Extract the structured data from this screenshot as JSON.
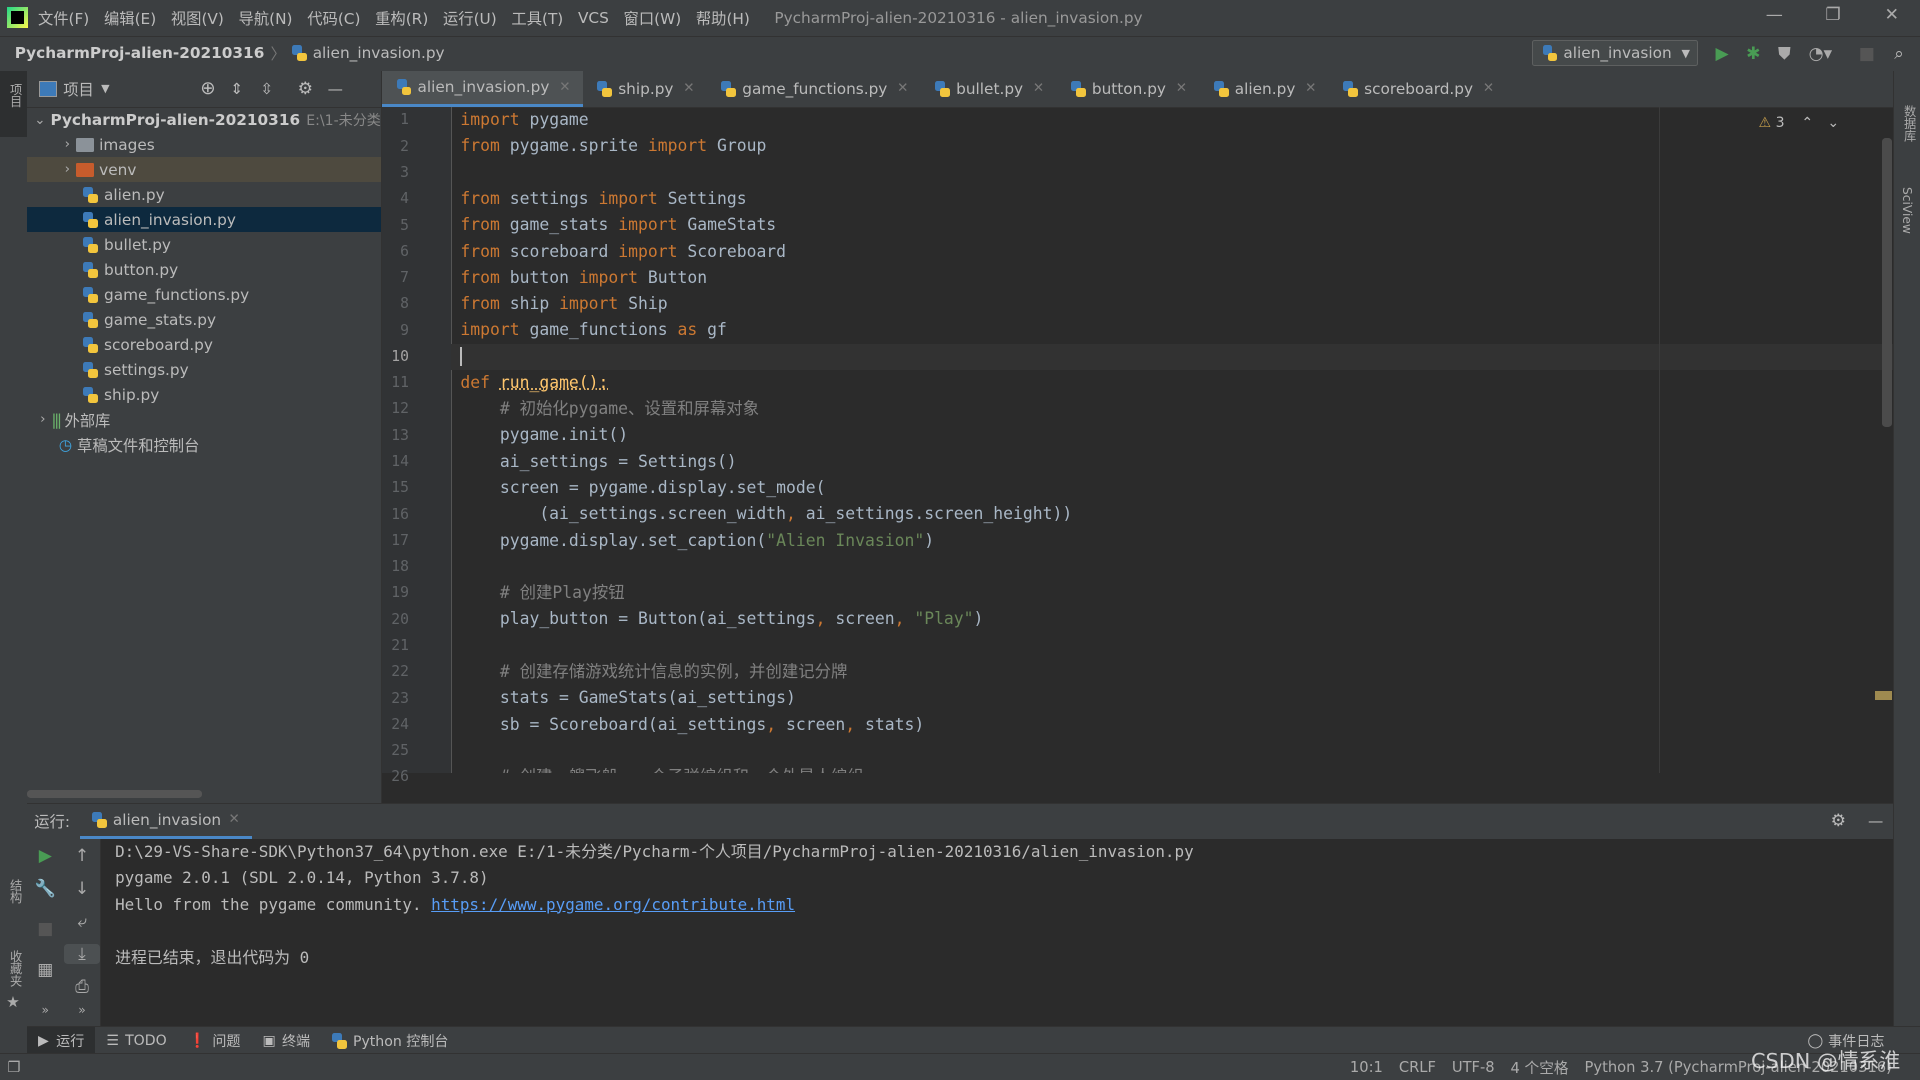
{
  "window": {
    "title": "PycharmProj-alien-20210316 - alien_invasion.py",
    "menu": [
      "文件(F)",
      "编辑(E)",
      "视图(V)",
      "导航(N)",
      "代码(C)",
      "重构(R)",
      "运行(U)",
      "工具(T)",
      "VCS",
      "窗口(W)",
      "帮助(H)"
    ]
  },
  "navbar": {
    "breadcrumb": [
      "PycharmProj-alien-20210316",
      "alien_invasion.py"
    ],
    "run_config": "alien_invasion"
  },
  "colors": {
    "accent": "#4a88c7",
    "keyword": "#cc7832",
    "string": "#6a8759",
    "comment": "#808080",
    "text": "#a9b7c6",
    "function": "#ffc66d",
    "link": "#589df6",
    "run_green": "#499c54"
  },
  "left_strip": {
    "project": "项目",
    "structure": "结构",
    "favorites": "收藏夹"
  },
  "right_strip": {
    "database": "数据库",
    "sciview": "SciView"
  },
  "project": {
    "header": "项目",
    "root": {
      "name": "PycharmProj-alien-20210316",
      "path": "E:\\1-未分类"
    },
    "items": [
      {
        "name": "images",
        "type": "folder"
      },
      {
        "name": "venv",
        "type": "venv"
      },
      {
        "name": "alien.py",
        "type": "py"
      },
      {
        "name": "alien_invasion.py",
        "type": "py",
        "selected": true
      },
      {
        "name": "bullet.py",
        "type": "py"
      },
      {
        "name": "button.py",
        "type": "py"
      },
      {
        "name": "game_functions.py",
        "type": "py"
      },
      {
        "name": "game_stats.py",
        "type": "py"
      },
      {
        "name": "scoreboard.py",
        "type": "py"
      },
      {
        "name": "settings.py",
        "type": "py"
      },
      {
        "name": "ship.py",
        "type": "py"
      }
    ],
    "external_libs": "外部库",
    "scratches": "草稿文件和控制台"
  },
  "tabs": [
    {
      "label": "alien_invasion.py",
      "active": true
    },
    {
      "label": "ship.py"
    },
    {
      "label": "game_functions.py"
    },
    {
      "label": "bullet.py"
    },
    {
      "label": "button.py"
    },
    {
      "label": "alien.py"
    },
    {
      "label": "scoreboard.py"
    }
  ],
  "editor": {
    "warnings": "3",
    "current_line": 10,
    "lines": [
      [
        [
          "kw",
          "import"
        ],
        [
          "pl",
          " pygame"
        ]
      ],
      [
        [
          "kw",
          "from"
        ],
        [
          "pl",
          " pygame.sprite "
        ],
        [
          "kw",
          "import"
        ],
        [
          "pl",
          " Group"
        ]
      ],
      [],
      [
        [
          "kw",
          "from"
        ],
        [
          "pl",
          " settings "
        ],
        [
          "kw",
          "import"
        ],
        [
          "pl",
          " Settings"
        ]
      ],
      [
        [
          "kw",
          "from"
        ],
        [
          "pl",
          " game_stats "
        ],
        [
          "kw",
          "import"
        ],
        [
          "pl",
          " GameStats"
        ]
      ],
      [
        [
          "kw",
          "from"
        ],
        [
          "pl",
          " scoreboard "
        ],
        [
          "kw",
          "import"
        ],
        [
          "pl",
          " Scoreboard"
        ]
      ],
      [
        [
          "kw",
          "from"
        ],
        [
          "pl",
          " button "
        ],
        [
          "kw",
          "import"
        ],
        [
          "pl",
          " Button"
        ]
      ],
      [
        [
          "kw",
          "from"
        ],
        [
          "pl",
          " ship "
        ],
        [
          "kw",
          "import"
        ],
        [
          "pl",
          " Ship"
        ]
      ],
      [
        [
          "kw",
          "import"
        ],
        [
          "pl",
          " game_functions "
        ],
        [
          "kw",
          "as"
        ],
        [
          "pl",
          " gf"
        ]
      ],
      [],
      [
        [
          "kw",
          "def"
        ],
        [
          "pl",
          " "
        ],
        [
          "fn",
          "run_game():"
        ]
      ],
      [
        [
          "cm",
          "    # 初始化pygame、设置和屏幕对象"
        ]
      ],
      [
        [
          "pl",
          "    pygame.init()"
        ]
      ],
      [
        [
          "pl",
          "    ai_settings = Settings()"
        ]
      ],
      [
        [
          "pl",
          "    screen = pygame.display.set_mode("
        ]
      ],
      [
        [
          "pl",
          "        (ai_settings.screen_width"
        ],
        [
          "kw",
          ","
        ],
        [
          "pl",
          " ai_settings.screen_height))"
        ]
      ],
      [
        [
          "pl",
          "    pygame.display.set_caption("
        ],
        [
          "st",
          "\"Alien Invasion\""
        ],
        [
          "pl",
          ")"
        ]
      ],
      [],
      [
        [
          "cm",
          "    # 创建Play按钮"
        ]
      ],
      [
        [
          "pl",
          "    play_button = Button(ai_settings"
        ],
        [
          "kw",
          ","
        ],
        [
          "pl",
          " screen"
        ],
        [
          "kw",
          ","
        ],
        [
          "pl",
          " "
        ],
        [
          "st",
          "\"Play\""
        ],
        [
          "pl",
          ")"
        ]
      ],
      [],
      [
        [
          "cm",
          "    # 创建存储游戏统计信息的实例，并创建记分牌"
        ]
      ],
      [
        [
          "pl",
          "    stats = GameStats(ai_settings)"
        ]
      ],
      [
        [
          "pl",
          "    sb = Scoreboard(ai_settings"
        ],
        [
          "kw",
          ","
        ],
        [
          "pl",
          " screen"
        ],
        [
          "kw",
          ","
        ],
        [
          "pl",
          " stats)"
        ]
      ],
      [],
      [
        [
          "cm",
          "    # 创建一艘飞船、一个子弹编组和一个外星人编组"
        ]
      ]
    ]
  },
  "run": {
    "label": "运行:",
    "tab": "alien_invasion",
    "output": [
      "D:\\29-VS-Share-SDK\\Python37_64\\python.exe E:/1-未分类/Pycharm-个人项目/PycharmProj-alien-20210316/alien_invasion.py",
      "pygame 2.0.1 (SDL 2.0.14, Python 3.7.8)",
      "Hello from the pygame community. ",
      "",
      "进程已结束，退出代码为 0"
    ],
    "link": "https://www.pygame.org/contribute.html"
  },
  "bottom_tabs": [
    "运行",
    "TODO",
    "问题",
    "终端",
    "Python 控制台"
  ],
  "event_log": "事件日志",
  "status": [
    "10:1",
    "CRLF",
    "UTF-8",
    "4 个空格",
    "Python 3.7 (PycharmProj-alien-20210316)"
  ],
  "watermark": "CSDN @情系淮思"
}
